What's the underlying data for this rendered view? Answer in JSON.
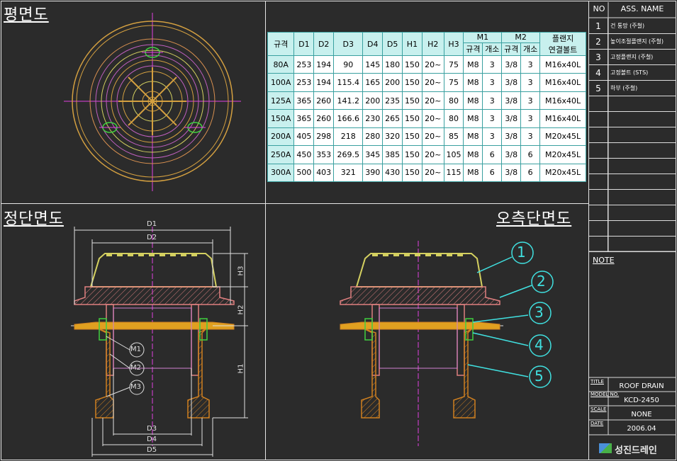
{
  "titles": {
    "plan": "평면도",
    "front": "정단면도",
    "side": "오측단면도"
  },
  "spec_table": {
    "headers": [
      "규격",
      "D1",
      "D2",
      "D3",
      "D4",
      "D5",
      "H1",
      "H2",
      "H3"
    ],
    "m1": "M1",
    "m2": "M2",
    "sub_size": "규격",
    "sub_qty": "개소",
    "flange_l1": "플랜지",
    "flange_l2": "연결볼트",
    "rows": [
      [
        "80A",
        "253",
        "194",
        "90",
        "145",
        "180",
        "150",
        "20~",
        "75",
        "M8",
        "3",
        "3/8",
        "3",
        "M16x40L"
      ],
      [
        "100A",
        "253",
        "194",
        "115.4",
        "165",
        "200",
        "150",
        "20~",
        "75",
        "M8",
        "3",
        "3/8",
        "3",
        "M16x40L"
      ],
      [
        "125A",
        "365",
        "260",
        "141.2",
        "200",
        "235",
        "150",
        "20~",
        "80",
        "M8",
        "3",
        "3/8",
        "3",
        "M16x40L"
      ],
      [
        "150A",
        "365",
        "260",
        "166.6",
        "230",
        "265",
        "150",
        "20~",
        "80",
        "M8",
        "3",
        "3/8",
        "3",
        "M16x40L"
      ],
      [
        "200A",
        "405",
        "298",
        "218",
        "280",
        "320",
        "150",
        "20~",
        "85",
        "M8",
        "3",
        "3/8",
        "3",
        "M20x45L"
      ],
      [
        "250A",
        "450",
        "353",
        "269.5",
        "345",
        "385",
        "150",
        "20~",
        "105",
        "M8",
        "6",
        "3/8",
        "6",
        "M20x45L"
      ],
      [
        "300A",
        "500",
        "403",
        "321",
        "390",
        "430",
        "150",
        "20~",
        "115",
        "M8",
        "6",
        "3/8",
        "6",
        "M20x45L"
      ]
    ]
  },
  "parts": {
    "header_no": "NO",
    "header_name": "ASS. NAME",
    "items": [
      {
        "no": "1",
        "name": "건 통망 (주철)"
      },
      {
        "no": "2",
        "name": "높이조절플랜지 (주철)"
      },
      {
        "no": "3",
        "name": "고정플랜지 (주철)"
      },
      {
        "no": "4",
        "name": "고정볼트 (STS)"
      },
      {
        "no": "5",
        "name": "하부 (주철)"
      }
    ]
  },
  "note_label": "NOTE",
  "title_block": {
    "title_lbl": "TITLE",
    "title_val": "ROOF DRAIN",
    "model_lbl": "MODEL NO.",
    "model_val": "KCD-2450",
    "scale_lbl": "SCALE",
    "scale_val": "NONE",
    "date_lbl": "DATE",
    "date_val": "2006.04",
    "company": "성진드레인"
  },
  "dims": {
    "d1": "D1",
    "d2": "D2",
    "d3": "D3",
    "d4": "D4",
    "d5": "D5",
    "h1": "H1",
    "h2": "H2",
    "h3": "H3",
    "m1": "M1",
    "m2": "M2",
    "m3": "M3"
  },
  "balloons": [
    "1",
    "2",
    "3",
    "4",
    "5"
  ]
}
